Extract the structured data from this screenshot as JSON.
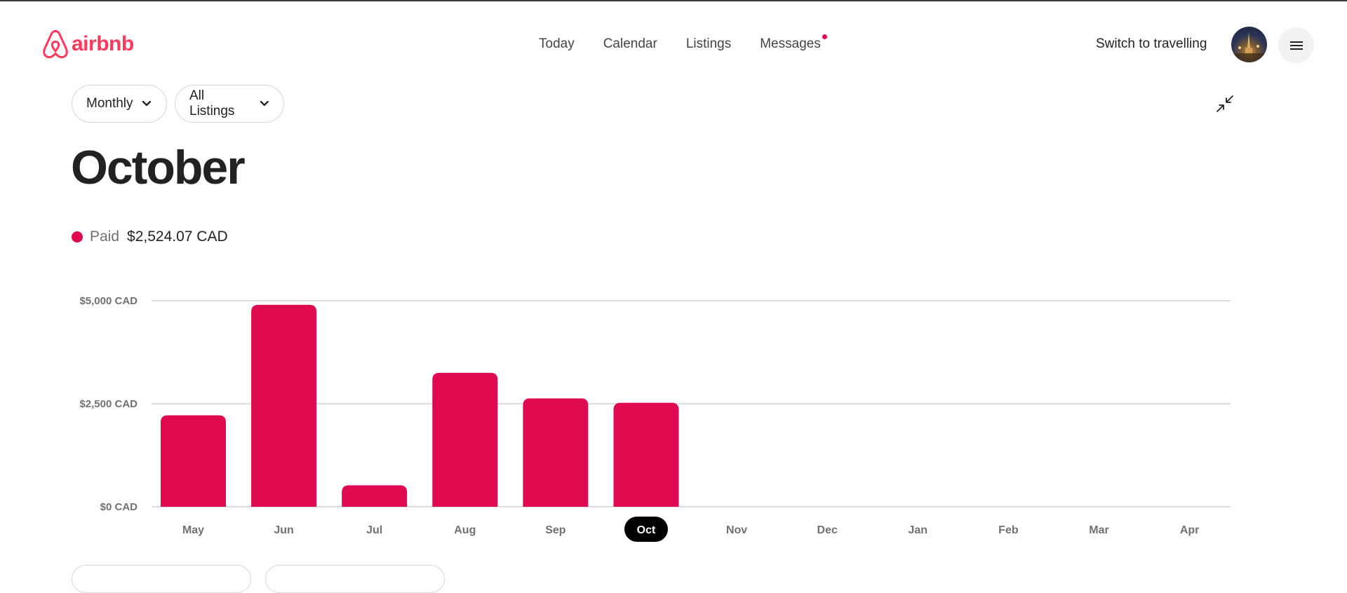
{
  "header": {
    "logo_text": "airbnb",
    "nav": [
      "Today",
      "Calendar",
      "Listings",
      "Messages"
    ],
    "switch_label": "Switch to travelling"
  },
  "filters": {
    "period": "Monthly",
    "listings": "All Listings"
  },
  "page_title": "October",
  "legend": {
    "label": "Paid",
    "value": "$2,524.07 CAD"
  },
  "colors": {
    "accent": "#e00b4f",
    "brand": "#ff385c"
  },
  "chart_data": {
    "type": "bar",
    "categories": [
      "May",
      "Jun",
      "Jul",
      "Aug",
      "Sep",
      "Oct",
      "Nov",
      "Dec",
      "Jan",
      "Feb",
      "Mar",
      "Apr"
    ],
    "values": [
      2220,
      4900,
      520,
      3250,
      2630,
      2524.07,
      0,
      0,
      0,
      0,
      0,
      0
    ],
    "ticks": [
      "$0 CAD",
      "$2,500 CAD",
      "$5,000 CAD"
    ],
    "tick_values": [
      0,
      2500,
      5000
    ],
    "ylim": [
      0,
      5000
    ],
    "selected": "Oct",
    "grid": true
  }
}
